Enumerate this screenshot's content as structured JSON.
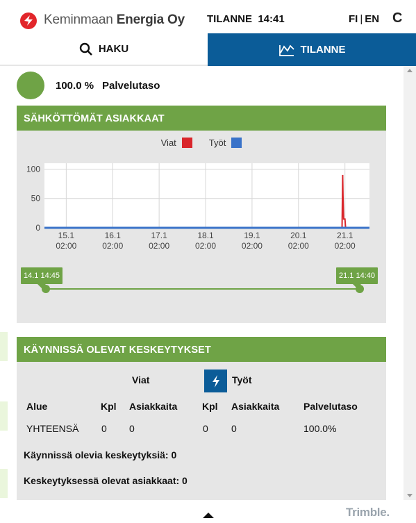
{
  "header": {
    "logo_thin": "Keminmaan",
    "logo_bold": "Energia Oy",
    "status_label": "TILANNE",
    "status_time": "14:41",
    "lang_fi": "FI",
    "lang_sep": "|",
    "lang_en": "EN",
    "refresh_glyph": "C",
    "brand_color": "#e2262b"
  },
  "tabs": [
    {
      "label": "HAKU",
      "icon": "search-icon",
      "active": false
    },
    {
      "label": "TILANNE",
      "icon": "chart-line-icon",
      "active": true
    }
  ],
  "service": {
    "percent": "100.0 %",
    "label": "Palvelutaso",
    "status_color": "#6fa346"
  },
  "outages_chart_panel": {
    "title": "SÄHKÖTTÖMÄT ASIAKKAAT",
    "legend": [
      {
        "label": "Viat",
        "color": "#d9262b"
      },
      {
        "label": "Työt",
        "color": "#3a73c9"
      }
    ],
    "range_start": "14.1 14:45",
    "range_end": "21.1 14:40"
  },
  "chart_data": {
    "type": "line",
    "title": "",
    "xlabel": "",
    "ylabel": "",
    "ylim": [
      0,
      110
    ],
    "yticks": [
      "0",
      "50",
      "100"
    ],
    "xticks": [
      {
        "date": "15.1",
        "time": "02:00"
      },
      {
        "date": "16.1",
        "time": "02:00"
      },
      {
        "date": "17.1",
        "time": "02:00"
      },
      {
        "date": "18.1",
        "time": "02:00"
      },
      {
        "date": "19.1",
        "time": "02:00"
      },
      {
        "date": "20.1",
        "time": "02:00"
      },
      {
        "date": "21.1",
        "time": "02:00"
      }
    ],
    "series": [
      {
        "name": "Viat",
        "color": "#d9262b",
        "x": [
          "14.1 14:45",
          "21.1 00:30",
          "21.1 00:50",
          "21.1 01:00",
          "21.1 01:20",
          "21.1 01:40",
          "21.1 02:00",
          "21.1 02:20",
          "21.1 02:40",
          "21.1 14:40"
        ],
        "values": [
          0,
          0,
          90,
          55,
          15,
          15,
          15,
          0,
          0,
          0
        ]
      },
      {
        "name": "Työt",
        "color": "#3a73c9",
        "x": [
          "14.1 14:45",
          "21.1 14:40"
        ],
        "values": [
          0,
          0
        ]
      }
    ]
  },
  "interruptions_panel": {
    "title": "KÄYNNISSÄ OLEVAT KESKEYTYKSET",
    "group_viat": "Viat",
    "group_tyot": "Työt",
    "columns": [
      "Alue",
      "Kpl",
      "Asiakkaita",
      "Kpl",
      "Asiakkaita",
      "Palvelutaso"
    ],
    "rows": [
      [
        "YHTEENSÄ",
        "0",
        "0",
        "0",
        "0",
        "100.0%"
      ]
    ],
    "summary_running": "Käynnissä olevia keskeytyksiä: 0",
    "summary_customers": "Keskeytyksessä olevat asiakkaat: 0"
  },
  "footer": {
    "brand": "Trimble."
  }
}
